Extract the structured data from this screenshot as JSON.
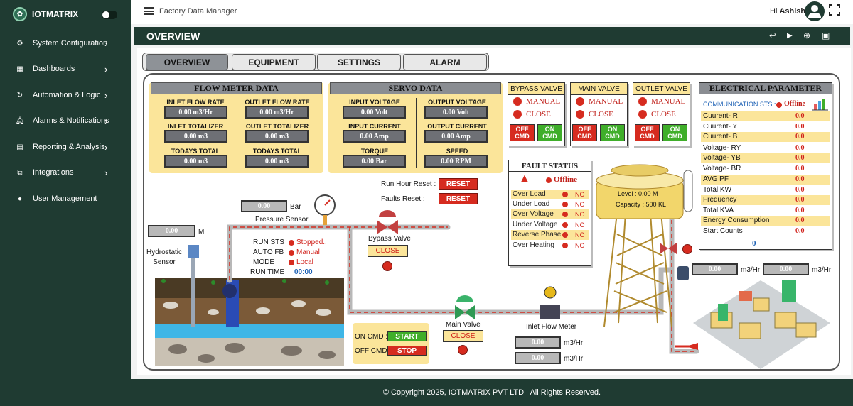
{
  "brand": {
    "name": "IOTMATRIX"
  },
  "sidebar": {
    "items": [
      {
        "label": "System Configuration",
        "icon": "gear-icon"
      },
      {
        "label": "Dashboards",
        "icon": "grid-icon"
      },
      {
        "label": "Automation & Logic",
        "icon": "refresh-icon"
      },
      {
        "label": "Alarms & Notifications",
        "icon": "bell-icon"
      },
      {
        "label": "Reporting & Analysis",
        "icon": "chart-icon"
      },
      {
        "label": "Integrations",
        "icon": "plug-icon"
      },
      {
        "label": "User Management",
        "icon": "user-icon"
      }
    ]
  },
  "topbar": {
    "app_name": "Factory Data Manager",
    "greeting": "Hi",
    "user": "Ashish"
  },
  "page": {
    "title": "OVERVIEW"
  },
  "tabs": [
    "OVERVIEW",
    "EQUIPMENT",
    "SETTINGS",
    "ALARM"
  ],
  "flow_meter": {
    "title": "FLOW METER DATA",
    "inlet_flow_rate_label": "INLET FLOW RATE",
    "inlet_flow_rate": "0.00 m3/Hr",
    "outlet_flow_rate_label": "OUTLET FLOW RATE",
    "outlet_flow_rate": "0.00 m3/Hr",
    "inlet_totalizer_label": "INLET TOTALIZER",
    "inlet_totalizer": "0.00 m3",
    "outlet_totalizer_label": "OUTLET TOTALIZER",
    "outlet_totalizer": "0.00 m3",
    "inlet_today_label": "TODAYS TOTAL",
    "inlet_today": "0.00 m3",
    "outlet_today_label": "TODAYS TOTAL",
    "outlet_today": "0.00 m3"
  },
  "servo": {
    "title": "SERVO DATA",
    "input_voltage_label": "INPUT VOLTAGE",
    "input_voltage": "0.00 Volt",
    "output_voltage_label": "OUTPUT VOLTAGE",
    "output_voltage": "0.00 Volt",
    "input_current_label": "INPUT CURRENT",
    "input_current": "0.00 Amp",
    "output_current_label": "OUTPUT CURRENT",
    "output_current": "0.00 Amp",
    "torque_label": "TORQUE",
    "torque": "0.00 Bar",
    "speed_label": "SPEED",
    "speed": "0.00 RPM"
  },
  "valves": [
    {
      "title": "BYPASS VALVE",
      "manual": "MANUAL",
      "close": "CLOSE",
      "off_cmd": "OFF CMD",
      "on_cmd": "ON CMD"
    },
    {
      "title": "MAIN VALVE",
      "manual": "MANUAL",
      "close": "CLOSE",
      "off_cmd": "OFF CMD",
      "on_cmd": "ON CMD"
    },
    {
      "title": "OUTLET VALVE",
      "manual": "MANUAL",
      "close": "CLOSE",
      "off_cmd": "OFF CMD",
      "on_cmd": "ON CMD"
    }
  ],
  "fault": {
    "title": "FAULT STATUS",
    "status": "Offline",
    "rows": [
      {
        "label": "Over Load",
        "value": "NO"
      },
      {
        "label": "Under Load",
        "value": "NO"
      },
      {
        "label": "Over Voltage",
        "value": "NO"
      },
      {
        "label": "Under Voltage",
        "value": "NO"
      },
      {
        "label": "Reverse Phase",
        "value": "NO"
      },
      {
        "label": "Over Heating",
        "value": "NO"
      }
    ]
  },
  "electrical": {
    "title": "ELECTRICAL PARAMETER",
    "comm_label": "COMMUNICATION STS :",
    "comm_status": "Offline",
    "rows": [
      {
        "label": "Cuurent- R",
        "value": "0.0"
      },
      {
        "label": "Cuurent- Y",
        "value": "0.0"
      },
      {
        "label": "Cuurent- B",
        "value": "0.0"
      },
      {
        "label": "Voltage- RY",
        "value": "0.0"
      },
      {
        "label": "Voltage- YB",
        "value": "0.0"
      },
      {
        "label": "Voltage- BR",
        "value": "0.0"
      },
      {
        "label": "AVG PF",
        "value": "0.0"
      },
      {
        "label": "Total KW",
        "value": "0.0"
      },
      {
        "label": "Frequency",
        "value": "0.0"
      },
      {
        "label": "Total KVA",
        "value": "0.0"
      },
      {
        "label": "Energy Consumption",
        "value": "0.0"
      },
      {
        "label": "Start Counts",
        "value": "0.0"
      }
    ],
    "footer_value": "0"
  },
  "reset": {
    "run_hour_label": "Run Hour Reset :",
    "faults_label": "Faults Reset :",
    "button": "RESET"
  },
  "pressure": {
    "value": "0.00",
    "unit": "Bar",
    "label": "Pressure Sensor"
  },
  "hydro": {
    "value": "0.00",
    "unit": "M",
    "label": "Hydrostatic Sensor"
  },
  "pump_status": {
    "run_sts_label": "RUN STS",
    "run_sts": "Stopped..",
    "auto_fb_label": "AUTO FB",
    "auto_fb": "Manual",
    "mode_label": "MODE",
    "mode": "Local",
    "run_time_label": "RUN TIME",
    "run_time": "00:00"
  },
  "bypass_valve": {
    "label": "Bypass Valve",
    "state": "CLOSE"
  },
  "main_valve": {
    "label": "Main Valve",
    "state": "CLOSE"
  },
  "pump_cmd": {
    "on_label": "ON CMD :",
    "start": "START",
    "off_label": "OFF CMD :",
    "stop": "STOP"
  },
  "inlet_meter": {
    "label": "Inlet Flow Meter",
    "value1": "0.00",
    "unit1": "m3/Hr",
    "value2": "0.00",
    "unit2": "m3/Hr"
  },
  "tank": {
    "level": "Level : 0.00 M",
    "capacity": "Capacity : 500 KL"
  },
  "outlet_flow": {
    "value1": "0.00",
    "unit1": "m3/Hr",
    "value2": "0.00",
    "unit2": "m3/Hr"
  },
  "footer": {
    "text": "© Copyright 2025, IOTMATRIX PVT LTD | All Rights Reserved."
  },
  "colors": {
    "sidebar": "#1f3b32",
    "accent_yellow": "#fbe59a",
    "alarm_red": "#d62b1f",
    "ok_green": "#3fae2a"
  }
}
